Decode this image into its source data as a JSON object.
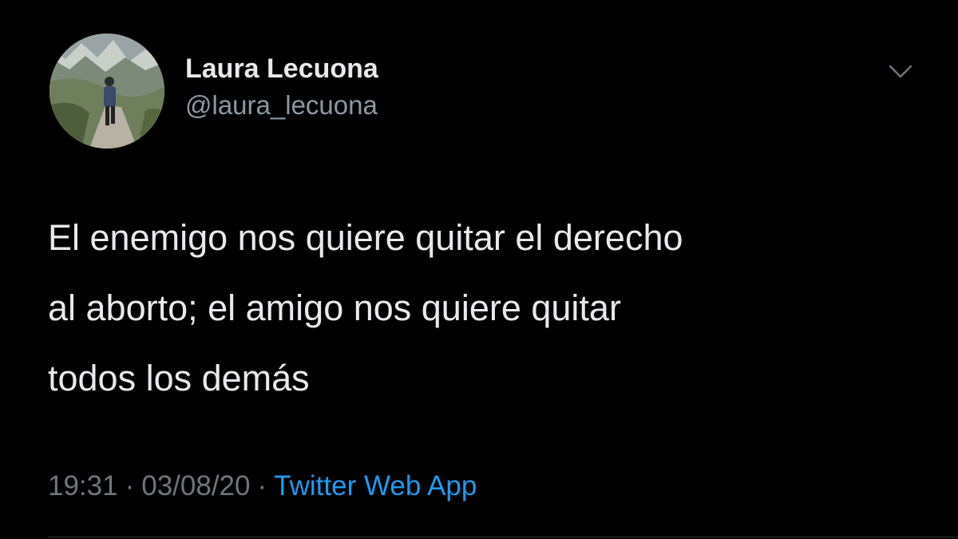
{
  "tweet": {
    "author": {
      "display_name": "Laura Lecuona",
      "handle": "@laura_lecuona"
    },
    "text": "El enemigo nos quiere quitar el derecho\nal aborto; el amigo nos quiere quitar\ntodos los demás",
    "time": "19:31",
    "separator": "·",
    "date": "03/08/20",
    "source": "Twitter Web App"
  },
  "icons": {
    "more": "chevron-down-icon"
  },
  "colors": {
    "background": "#000000",
    "text": "#e7e9ea",
    "secondary_text": "#6e767d",
    "link": "#1d9bf0"
  }
}
